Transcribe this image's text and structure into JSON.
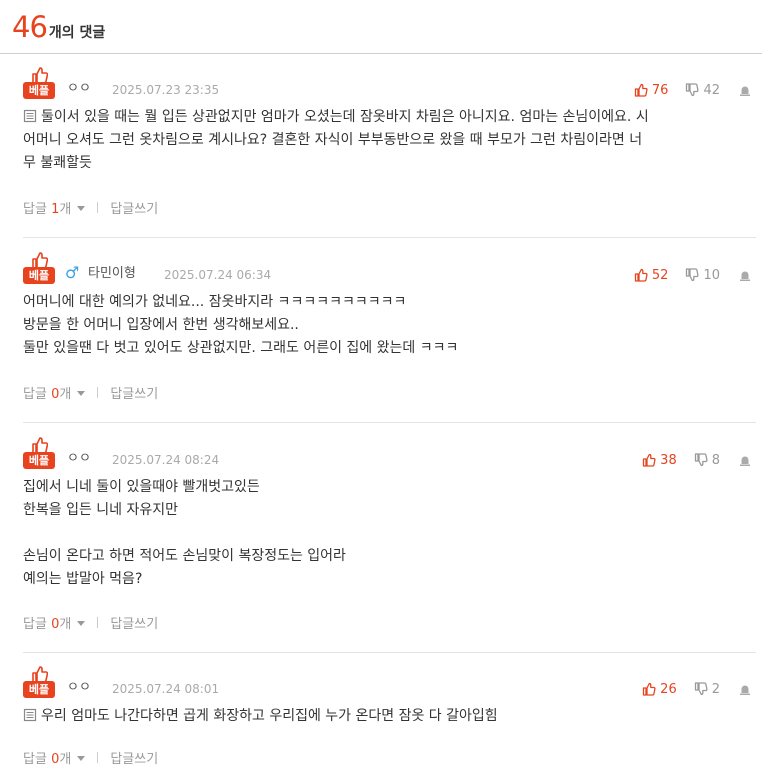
{
  "header": {
    "count": "46",
    "label": "개의 댓글"
  },
  "best_label": "베플",
  "reply_label": "답글",
  "reply_suffix": "개",
  "write_reply_label": "답글쓰기",
  "comments": [
    {
      "author": "ㅇㅇ",
      "gender": "",
      "date": "2025.07.23 23:35",
      "up": "76",
      "down": "42",
      "has_image": true,
      "text": "둘이서 있을 때는 뭘 입든 상관없지만 엄마가 오셨는데 잠옷바지 차림은 아니지요. 엄마는 손님이에요. 시\n어머니 오셔도 그런 옷차림으로 계시나요? 결혼한 자식이 부부동반으로 왔을 때 부모가 그런 차림이라면 너\n무 불쾌할듯",
      "replies": "1"
    },
    {
      "author": "타민이형",
      "gender": "♂",
      "date": "2025.07.24 06:34",
      "up": "52",
      "down": "10",
      "has_image": false,
      "text": "어머니에 대한 예의가 없네요... 잠옷바지라 ㅋㅋㅋㅋㅋㅋㅋㅋㅋㅋ\n방문을 한 어머니 입장에서 한번 생각해보세요..\n둘만 있을땐 다 벗고 있어도 상관없지만. 그래도 어른이 집에 왔는데 ㅋㅋㅋ",
      "replies": "0"
    },
    {
      "author": "ㅇㅇ",
      "gender": "",
      "date": "2025.07.24 08:24",
      "up": "38",
      "down": "8",
      "has_image": false,
      "text": "집에서 니네 둘이 있을때야 빨개벗고있든\n한복을 입든 니네 자유지만\n\n손님이 온다고 하면 적어도 손님맞이 복장정도는 입어라\n예의는 밥말아 먹음?",
      "replies": "0"
    },
    {
      "author": "ㅇㅇ",
      "gender": "",
      "date": "2025.07.24 08:01",
      "up": "26",
      "down": "2",
      "has_image": true,
      "text": "우리 엄마도 나간다하면 곱게 화장하고 우리집에 누가 온다면 잠옷 다 갈아입힘",
      "replies": "0"
    }
  ],
  "colors": {
    "accent": "#e8431f",
    "muted": "#999999",
    "divider": "#e4e4e4"
  },
  "icons": {
    "best": "thumbs-up-icon",
    "gender": "male-icon",
    "vote_up": "thumbs-up-icon",
    "vote_down": "thumbs-down-icon",
    "report": "siren-icon",
    "image": "image-icon",
    "caret": "chevron-down-icon"
  }
}
